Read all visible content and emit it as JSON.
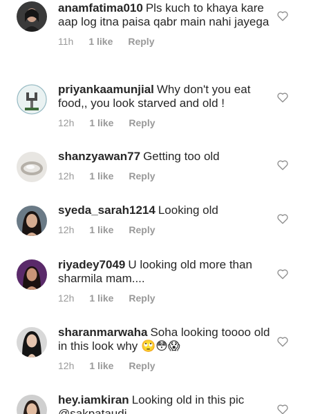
{
  "comments": [
    {
      "user": "anamfatima010",
      "text": "Pls kuch to khaya kare aap log itna paisa qabr main nahi jayega",
      "time": "11h",
      "likes": "1 like",
      "reply": "Reply",
      "avatar": "woman-dark-hair-avatar"
    },
    {
      "user": "priyankaamunjial",
      "text": "Why don't you eat food,, you look starved and old !",
      "time": "12h",
      "likes": "1 like",
      "reply": "Reply",
      "avatar": "hand-symbol-avatar"
    },
    {
      "user": "shanzyawan77",
      "text": "Getting too old",
      "time": "12h",
      "likes": "1 like",
      "reply": "Reply",
      "avatar": "ring-photo-avatar"
    },
    {
      "user": "syeda_sarah1214",
      "text": "Looking old",
      "time": "12h",
      "likes": "1 like",
      "reply": "Reply",
      "avatar": "woman-portrait-avatar"
    },
    {
      "user": "riyadey7049",
      "text": "U looking old more than sharmila mam....",
      "time": "12h",
      "likes": "1 like",
      "reply": "Reply",
      "avatar": "woman-purple-background-avatar"
    },
    {
      "user": "sharanmarwaha",
      "text": "Soha looking toooo old in this look why",
      "emoji": "🙄😳😱",
      "time": "12h",
      "likes": "1 like",
      "reply": "Reply",
      "avatar": "woman-long-hair-avatar"
    },
    {
      "user": "hey.iamkiran",
      "text": "Looking old in this pic",
      "text2": "@sakpataudi",
      "avatar": "woman-avatar"
    }
  ]
}
